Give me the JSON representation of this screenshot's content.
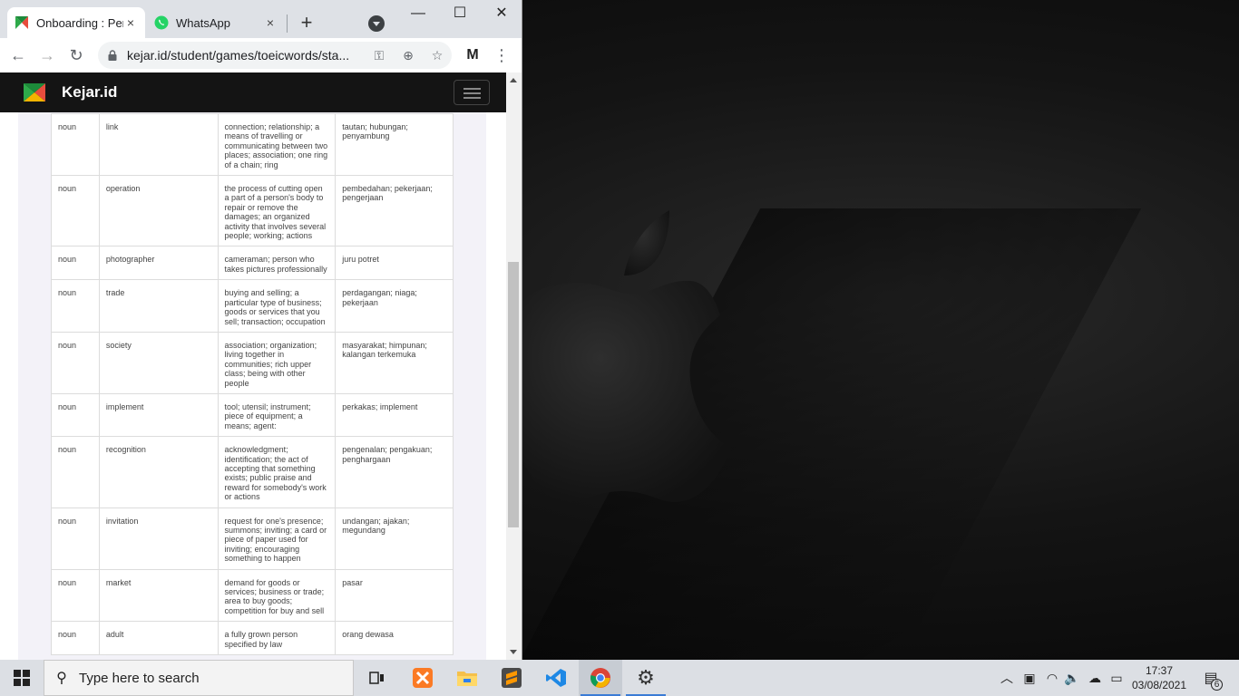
{
  "browser": {
    "tabs": [
      {
        "title": "Onboarding : Per",
        "active": true,
        "close": "×",
        "icon": "kejar-favicon"
      },
      {
        "title": "WhatsApp",
        "active": false,
        "close": "×",
        "icon": "whatsapp-favicon"
      }
    ],
    "new_tab": "+",
    "window_controls": {
      "minimize": "—",
      "maximize": "☐",
      "close": "✕"
    },
    "url": "kejar.id/student/games/toeicwords/sta..."
  },
  "site": {
    "brand": "Kejar.id"
  },
  "vocab_rows": [
    {
      "type": "noun",
      "word": "link",
      "definition": "connection; relationship; a means of travelling or communicating between two places; association; one ring of a chain; ring",
      "translation": "tautan; hubungan; penyambung"
    },
    {
      "type": "noun",
      "word": "operation",
      "definition": "the process of cutting open a part of a person's body to repair or remove the damages; an organized activity that involves several people; working; actions",
      "translation": "pembedahan; pekerjaan; pengerjaan"
    },
    {
      "type": "noun",
      "word": "photographer",
      "definition": "cameraman; person who takes pictures professionally",
      "translation": "juru potret"
    },
    {
      "type": "noun",
      "word": "trade",
      "definition": "buying and selling; a particular type of business; goods or services that you sell; transaction; occupation",
      "translation": "perdagangan; niaga; pekerjaan"
    },
    {
      "type": "noun",
      "word": "society",
      "definition": "association; organization; living together in communities; rich upper class; being with other people",
      "translation": "masyarakat; himpunan; kalangan terkemuka"
    },
    {
      "type": "noun",
      "word": "implement",
      "definition": "tool; utensil; instrument; piece of equipment; a means; agent:",
      "translation": "perkakas; implement"
    },
    {
      "type": "noun",
      "word": "recognition",
      "definition": "acknowledgment; identification; the act of accepting that something exists; public praise and reward for somebody's work or actions",
      "translation": "pengenalan; pengakuan; penghargaan"
    },
    {
      "type": "noun",
      "word": "invitation",
      "definition": "request for one's presence; summons; inviting; a card or piece of paper used for inviting; encouraging something to happen",
      "translation": "undangan; ajakan; megundang"
    },
    {
      "type": "noun",
      "word": "market",
      "definition": "demand for goods or services; business or trade; area to buy goods; competition for buy and sell",
      "translation": "pasar"
    },
    {
      "type": "noun",
      "word": "adult",
      "definition": "a fully grown person specified by law",
      "translation": "orang dewasa"
    }
  ],
  "taskbar": {
    "search_placeholder": "Type here to search",
    "time": "17:37",
    "date": "03/08/2021",
    "notification_count": "6"
  }
}
